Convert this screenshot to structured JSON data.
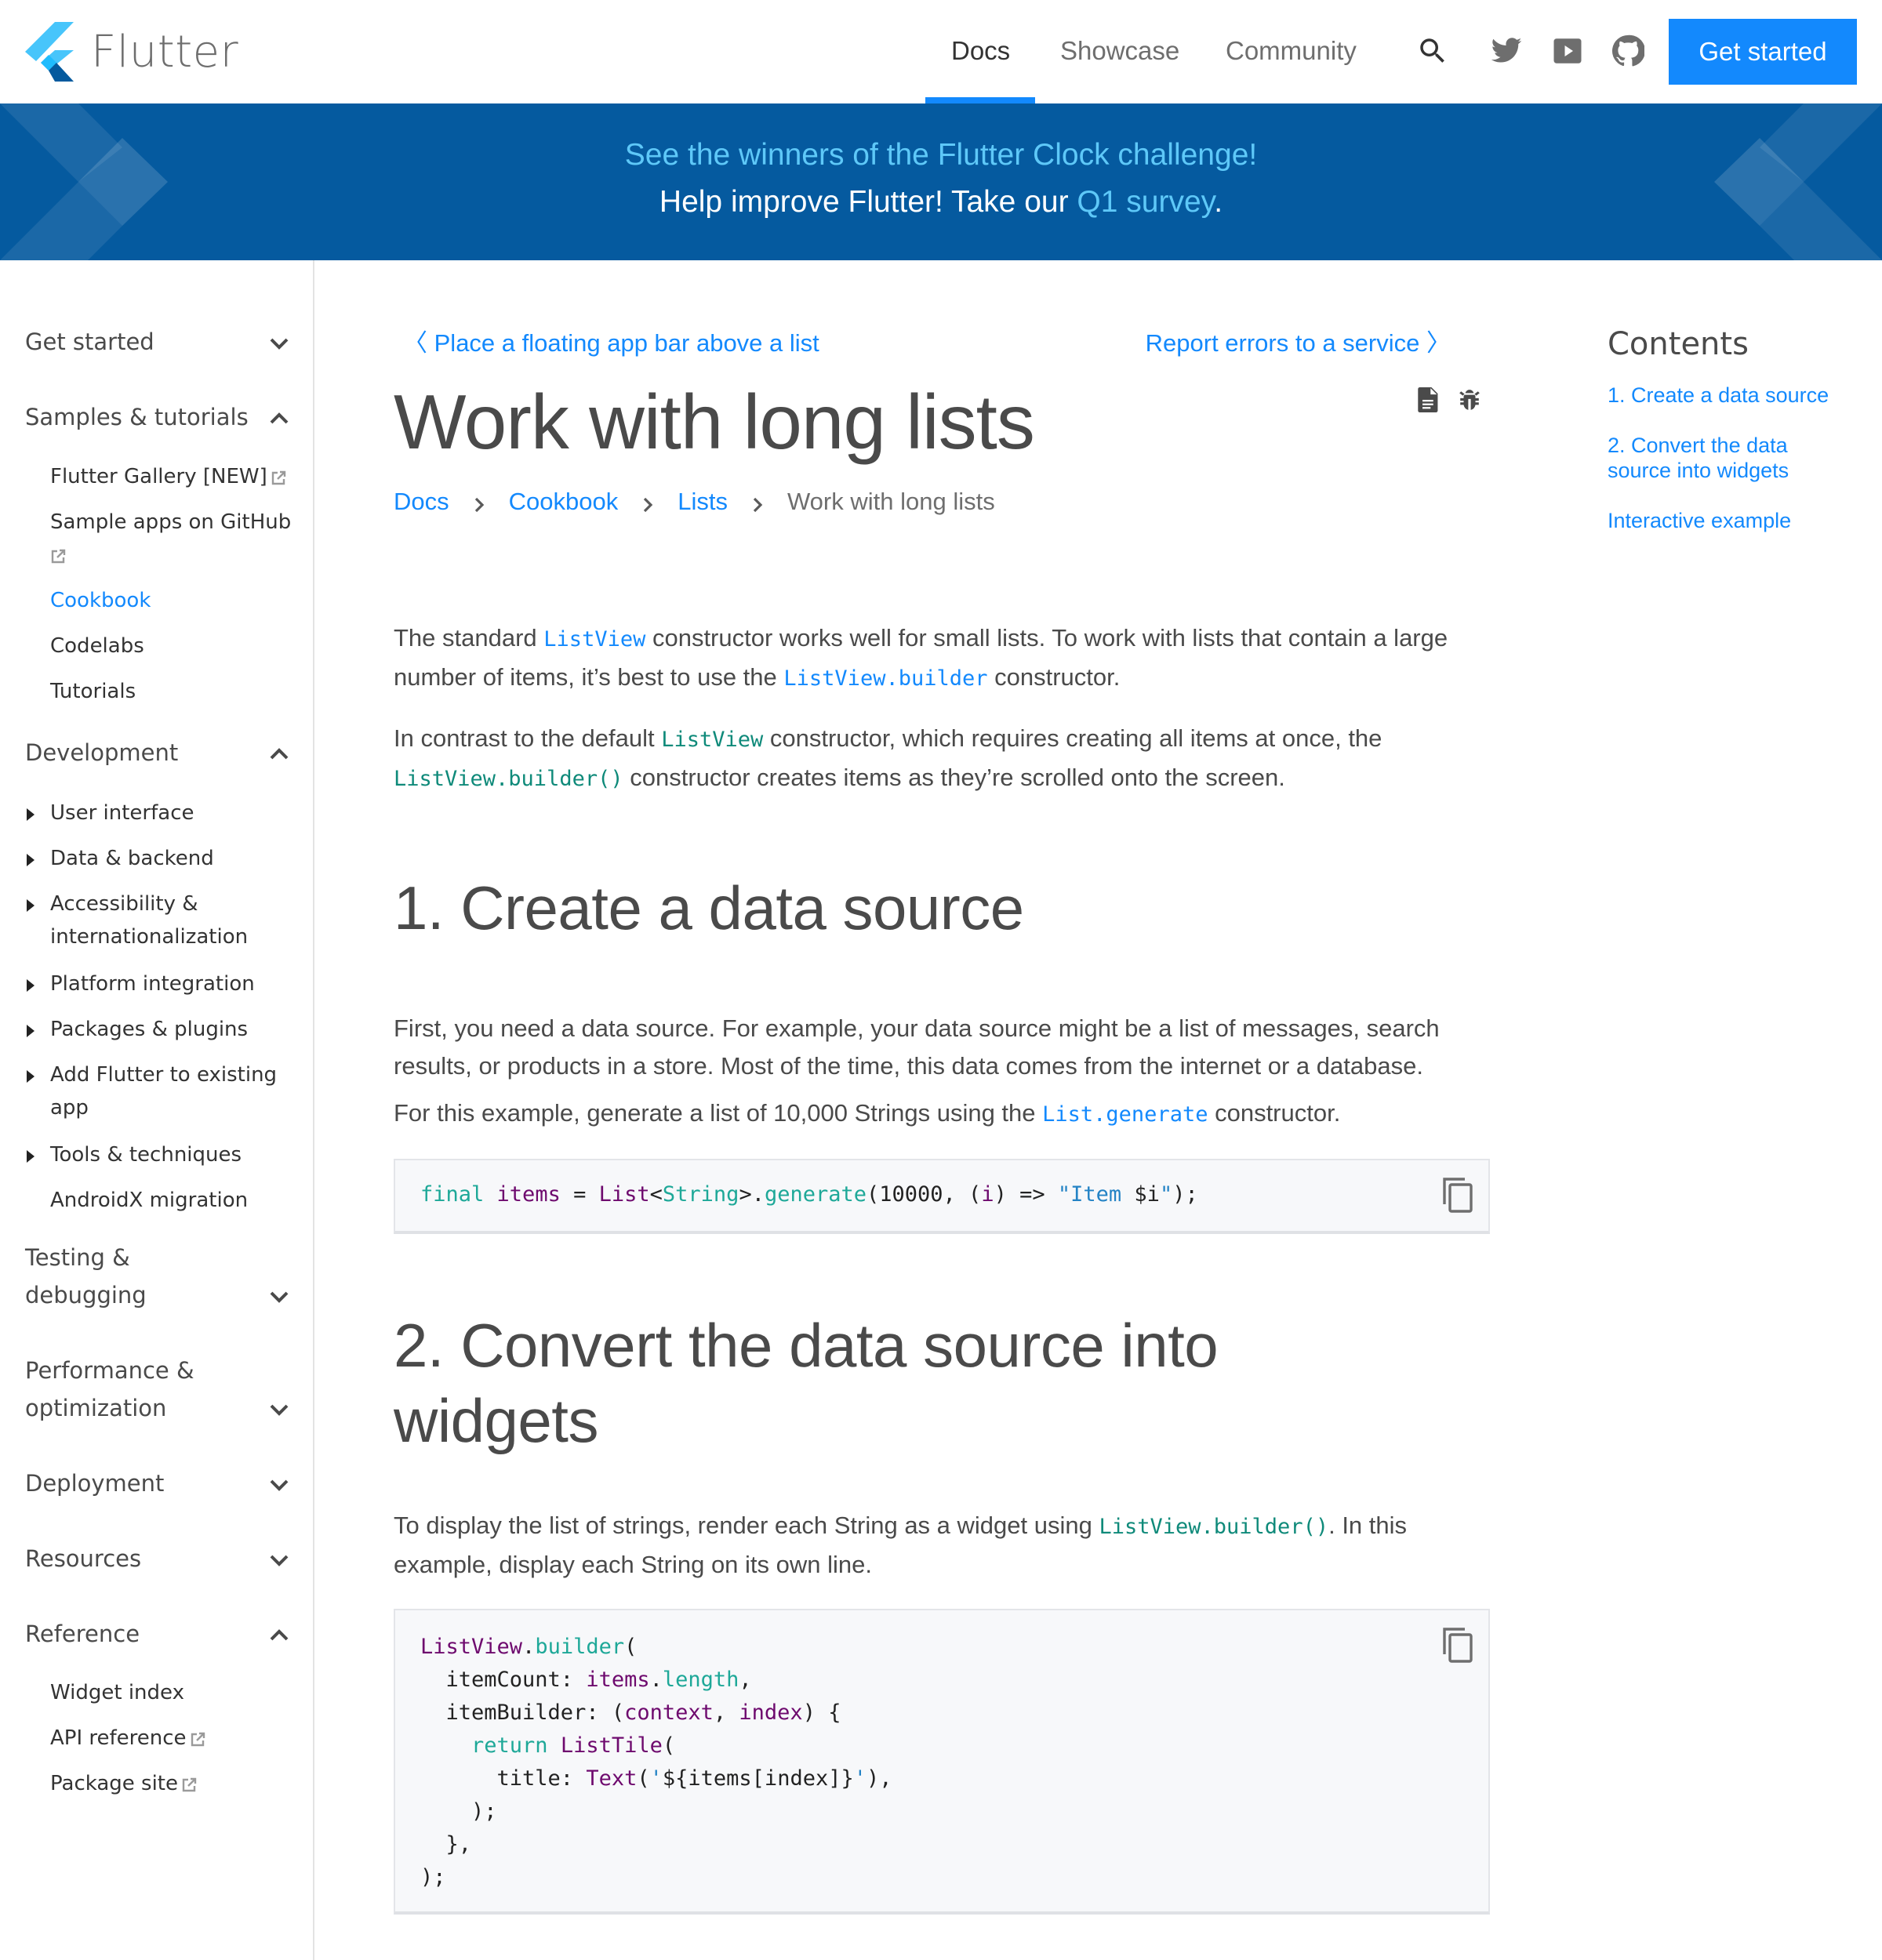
{
  "nav": {
    "brand": "Flutter",
    "links": [
      {
        "label": "Docs",
        "active": true
      },
      {
        "label": "Showcase",
        "active": false
      },
      {
        "label": "Community",
        "active": false
      }
    ],
    "icons": [
      "search-icon",
      "twitter-icon",
      "youtube-icon",
      "github-icon"
    ],
    "cta_label": "Get started",
    "accent_color": "#1389fd"
  },
  "banner": {
    "line1": "See the winners of the Flutter Clock challenge!",
    "line2_prefix": "Help improve Flutter! Take our ",
    "line2_link": "Q1 survey",
    "line2_suffix": ".",
    "background_color": "#055a9f"
  },
  "sidebar": {
    "sections": [
      {
        "label": "Get started",
        "expanded": false
      },
      {
        "label": "Samples & tutorials",
        "expanded": true,
        "items": [
          {
            "label": "Flutter Gallery [NEW]",
            "external": true
          },
          {
            "label": "Sample apps on GitHub",
            "external": true
          },
          {
            "label": "Cookbook",
            "active": true
          },
          {
            "label": "Codelabs"
          },
          {
            "label": "Tutorials"
          }
        ]
      },
      {
        "label": "Development",
        "expanded": true,
        "items": [
          {
            "label": "User interface",
            "collapsible": true
          },
          {
            "label": "Data & backend",
            "collapsible": true
          },
          {
            "label": "Accessibility & internationalization",
            "collapsible": true
          },
          {
            "label": "Platform integration",
            "collapsible": true
          },
          {
            "label": "Packages & plugins",
            "collapsible": true
          },
          {
            "label": "Add Flutter to existing app",
            "collapsible": true
          },
          {
            "label": "Tools & techniques",
            "collapsible": true
          },
          {
            "label": "AndroidX migration"
          }
        ]
      },
      {
        "label": "Testing & debugging",
        "expanded": false
      },
      {
        "label": "Performance & optimization",
        "expanded": false
      },
      {
        "label": "Deployment",
        "expanded": false
      },
      {
        "label": "Resources",
        "expanded": false
      },
      {
        "label": "Reference",
        "expanded": true,
        "items": [
          {
            "label": "Widget index"
          },
          {
            "label": "API reference",
            "external": true
          },
          {
            "label": "Package site",
            "external": true
          }
        ]
      }
    ]
  },
  "page": {
    "prev_link": "Place a floating app bar above a list",
    "next_link": "Report errors to a service",
    "title": "Work with long lists",
    "title_icons": [
      "document-icon",
      "bug-icon"
    ],
    "breadcrumbs": [
      "Docs",
      "Cookbook",
      "Lists",
      "Work with long lists"
    ],
    "intro": {
      "p1": {
        "a": "The standard ",
        "code1": "ListView",
        "b": " constructor works well for small lists. To work with lists that contain a large number of items, it’s best to use the ",
        "code2": "ListView.builder",
        "c": " constructor."
      },
      "p2": {
        "a": "In contrast to the default ",
        "code1": "ListView",
        "b": " constructor, which requires creating all items at once, the ",
        "code2": "ListView.builder()",
        "c": " constructor creates items as they’re scrolled onto the screen."
      }
    },
    "section1": {
      "heading": "1. Create a data source",
      "p1": "First, you need a data source. For example, your data source might be a list of messages, search results, or products in a store. Most of the time, this data comes from the internet or a database.",
      "p2": {
        "a": "For this example, generate a list of 10,000 Strings using the ",
        "code": "List.generate",
        "b": " constructor."
      },
      "code_tokens": [
        {
          "t": "final",
          "c": "teal"
        },
        {
          "t": " "
        },
        {
          "t": "items",
          "c": "purp"
        },
        {
          "t": " = "
        },
        {
          "t": "List",
          "c": "purp"
        },
        {
          "t": "<"
        },
        {
          "t": "String",
          "c": "teal"
        },
        {
          "t": ">."
        },
        {
          "t": "generate",
          "c": "teal"
        },
        {
          "t": "(10000, ("
        },
        {
          "t": "i",
          "c": "purp"
        },
        {
          "t": ") => "
        },
        {
          "t": "\"Item ",
          "c": "str"
        },
        {
          "t": "$i"
        },
        {
          "t": "\"",
          "c": "str"
        },
        {
          "t": ");"
        }
      ]
    },
    "section2": {
      "heading": "2. Convert the data source into widgets",
      "p1": {
        "a": "To display the list of strings, render each String as a widget using ",
        "code": "ListView.builder()",
        "b": ". In this example, display each String on its own line."
      },
      "code_lines": [
        [
          {
            "t": "ListView",
            "c": "purp"
          },
          {
            "t": "."
          },
          {
            "t": "builder",
            "c": "teal"
          },
          {
            "t": "("
          }
        ],
        [
          {
            "t": "  itemCount: "
          },
          {
            "t": "items",
            "c": "purp"
          },
          {
            "t": "."
          },
          {
            "t": "length",
            "c": "teal"
          },
          {
            "t": ","
          }
        ],
        [
          {
            "t": "  itemBuilder: ("
          },
          {
            "t": "context",
            "c": "purp"
          },
          {
            "t": ", "
          },
          {
            "t": "index",
            "c": "purp"
          },
          {
            "t": ") {"
          }
        ],
        [
          {
            "t": "    "
          },
          {
            "t": "return",
            "c": "teal"
          },
          {
            "t": " "
          },
          {
            "t": "ListTile",
            "c": "purp"
          },
          {
            "t": "("
          }
        ],
        [
          {
            "t": "      title: "
          },
          {
            "t": "Text",
            "c": "purp"
          },
          {
            "t": "("
          },
          {
            "t": "'",
            "c": "str"
          },
          {
            "t": "${items[index]}"
          },
          {
            "t": "'",
            "c": "str"
          },
          {
            "t": "),"
          }
        ],
        [
          {
            "t": "    );"
          }
        ],
        [
          {
            "t": "  },"
          }
        ],
        [
          {
            "t": ");"
          }
        ]
      ]
    }
  },
  "toc": {
    "title": "Contents",
    "links": [
      "1. Create a data source",
      "2. Convert the data source into widgets",
      "Interactive example"
    ]
  }
}
